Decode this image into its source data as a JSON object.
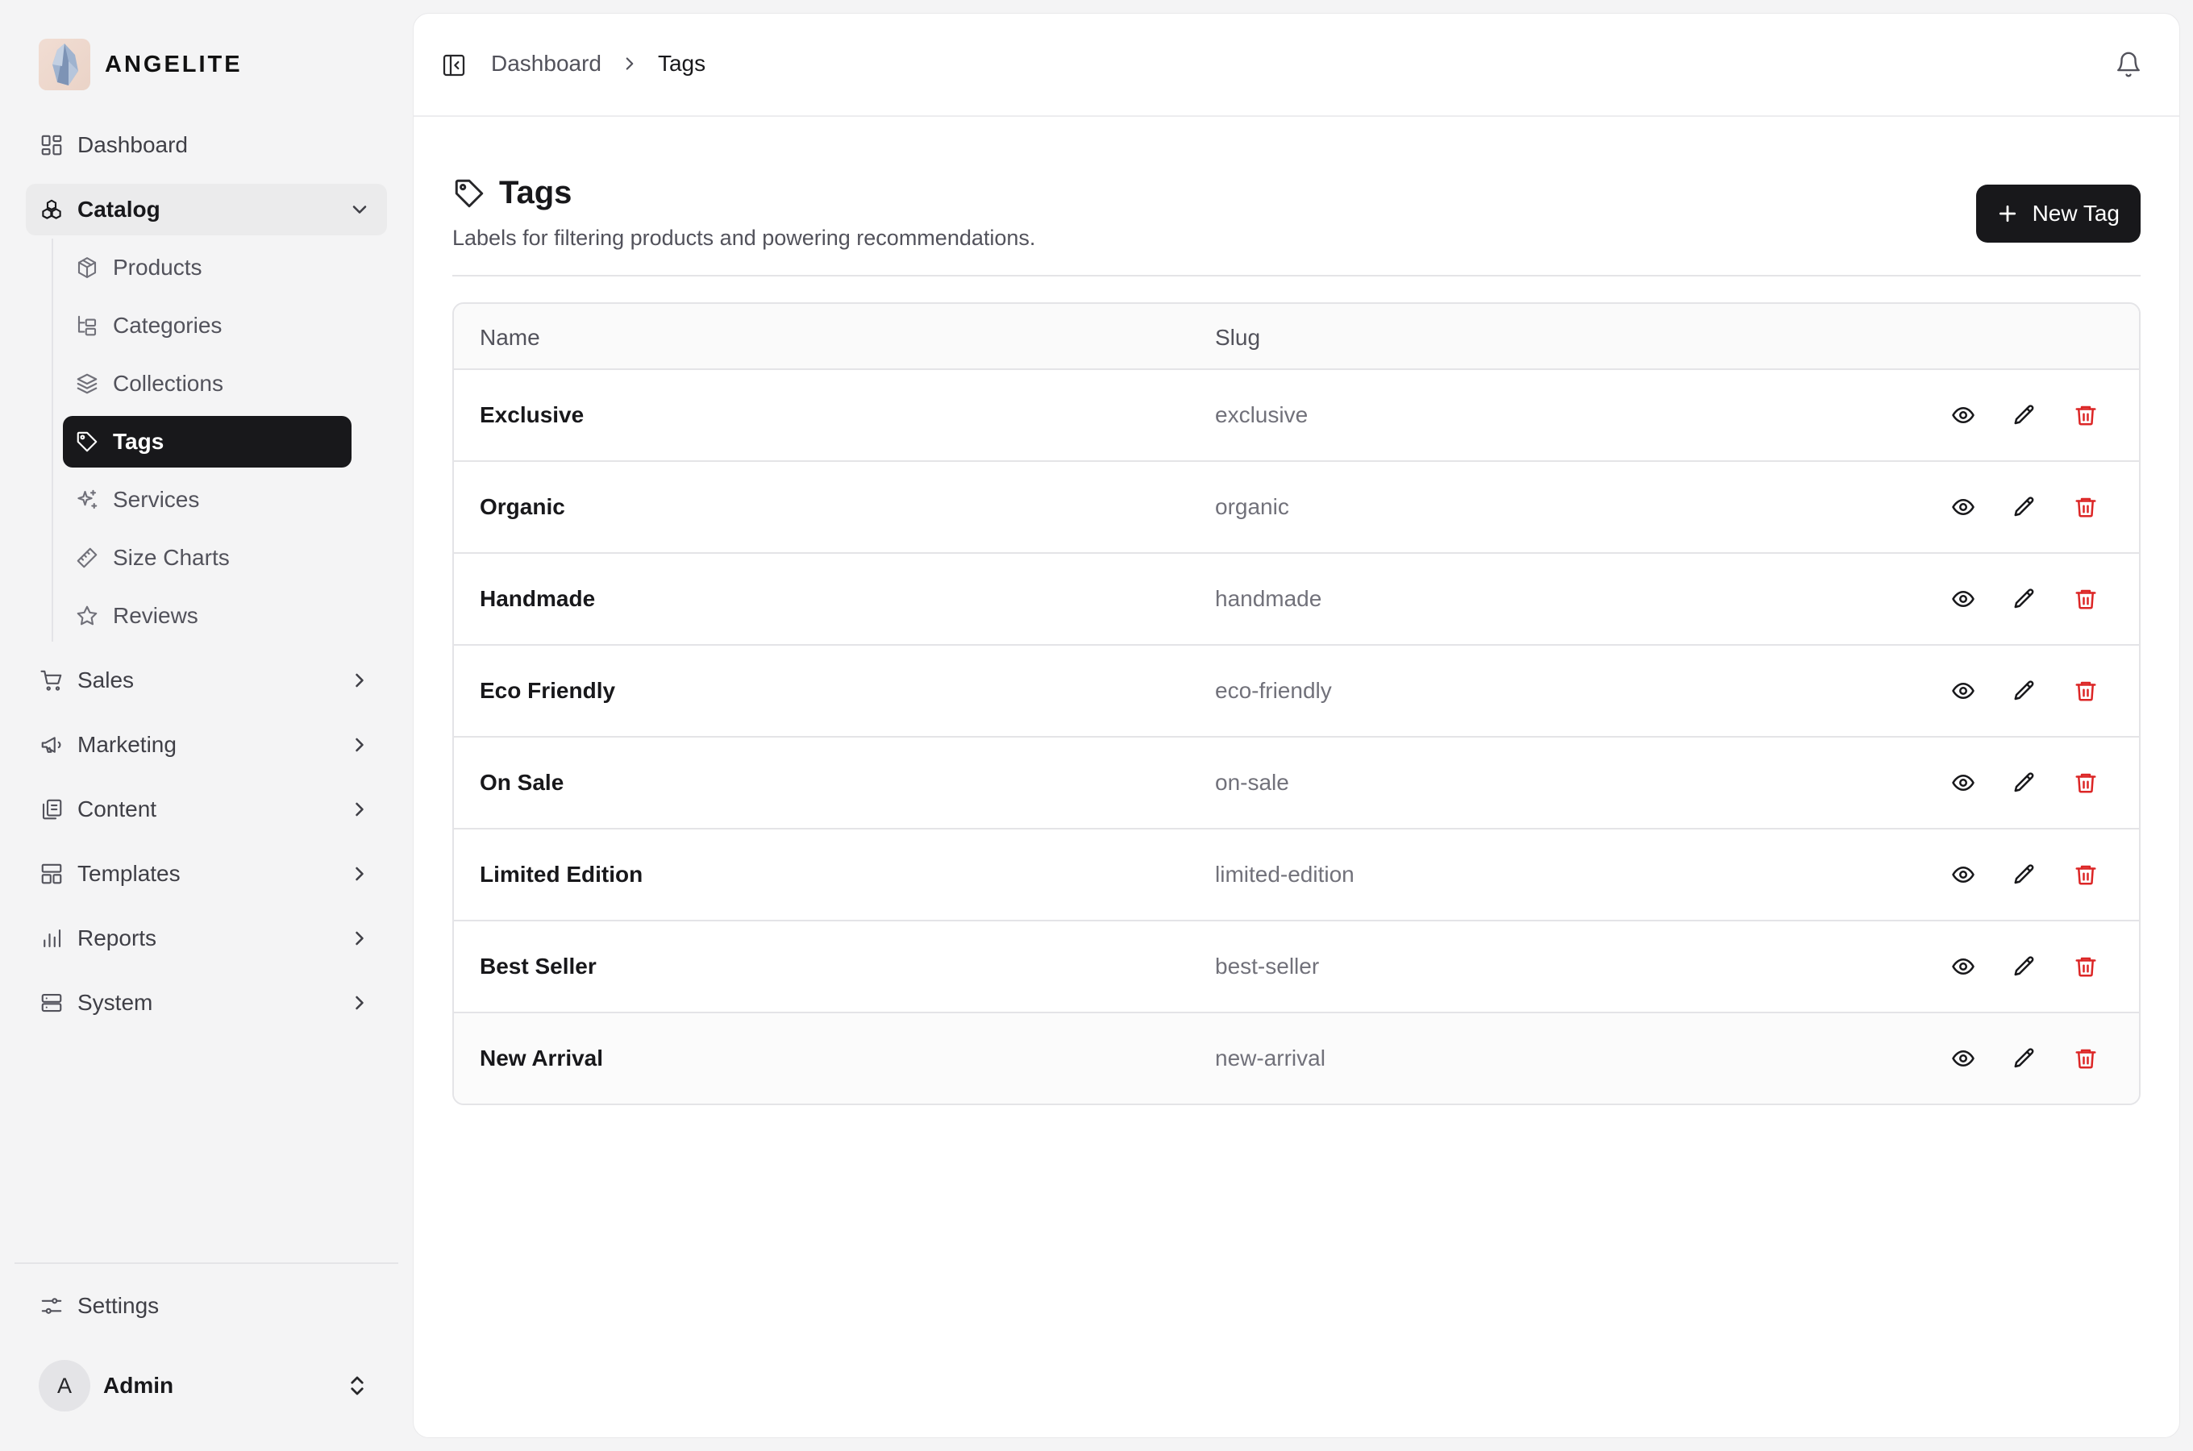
{
  "brand": {
    "name": "ANGELITE"
  },
  "nav": {
    "dashboard": "Dashboard",
    "catalog": "Catalog",
    "catalog_items": [
      {
        "label": "Products",
        "icon": "box-icon"
      },
      {
        "label": "Categories",
        "icon": "hierarchy-icon"
      },
      {
        "label": "Collections",
        "icon": "layers-icon"
      },
      {
        "label": "Tags",
        "icon": "tag-icon"
      },
      {
        "label": "Services",
        "icon": "sparkles-icon"
      },
      {
        "label": "Size Charts",
        "icon": "ruler-icon"
      },
      {
        "label": "Reviews",
        "icon": "star-icon"
      }
    ],
    "sales": "Sales",
    "marketing": "Marketing",
    "content": "Content",
    "templates": "Templates",
    "reports": "Reports",
    "system": "System",
    "settings": "Settings"
  },
  "user": {
    "initial": "A",
    "name": "Admin"
  },
  "breadcrumb": {
    "parent": "Dashboard",
    "current": "Tags"
  },
  "page": {
    "title": "Tags",
    "subtitle": "Labels for filtering products and powering recommendations.",
    "new_button": "New Tag"
  },
  "table": {
    "headers": {
      "name": "Name",
      "slug": "Slug"
    },
    "rows": [
      {
        "name": "Exclusive",
        "slug": "exclusive"
      },
      {
        "name": "Organic",
        "slug": "organic"
      },
      {
        "name": "Handmade",
        "slug": "handmade"
      },
      {
        "name": "Eco Friendly",
        "slug": "eco-friendly"
      },
      {
        "name": "On Sale",
        "slug": "on-sale"
      },
      {
        "name": "Limited Edition",
        "slug": "limited-edition"
      },
      {
        "name": "Best Seller",
        "slug": "best-seller"
      },
      {
        "name": "New Arrival",
        "slug": "new-arrival"
      }
    ]
  },
  "colors": {
    "accent": "#18181b",
    "danger": "#dc2626",
    "background": "#f4f4f5"
  }
}
